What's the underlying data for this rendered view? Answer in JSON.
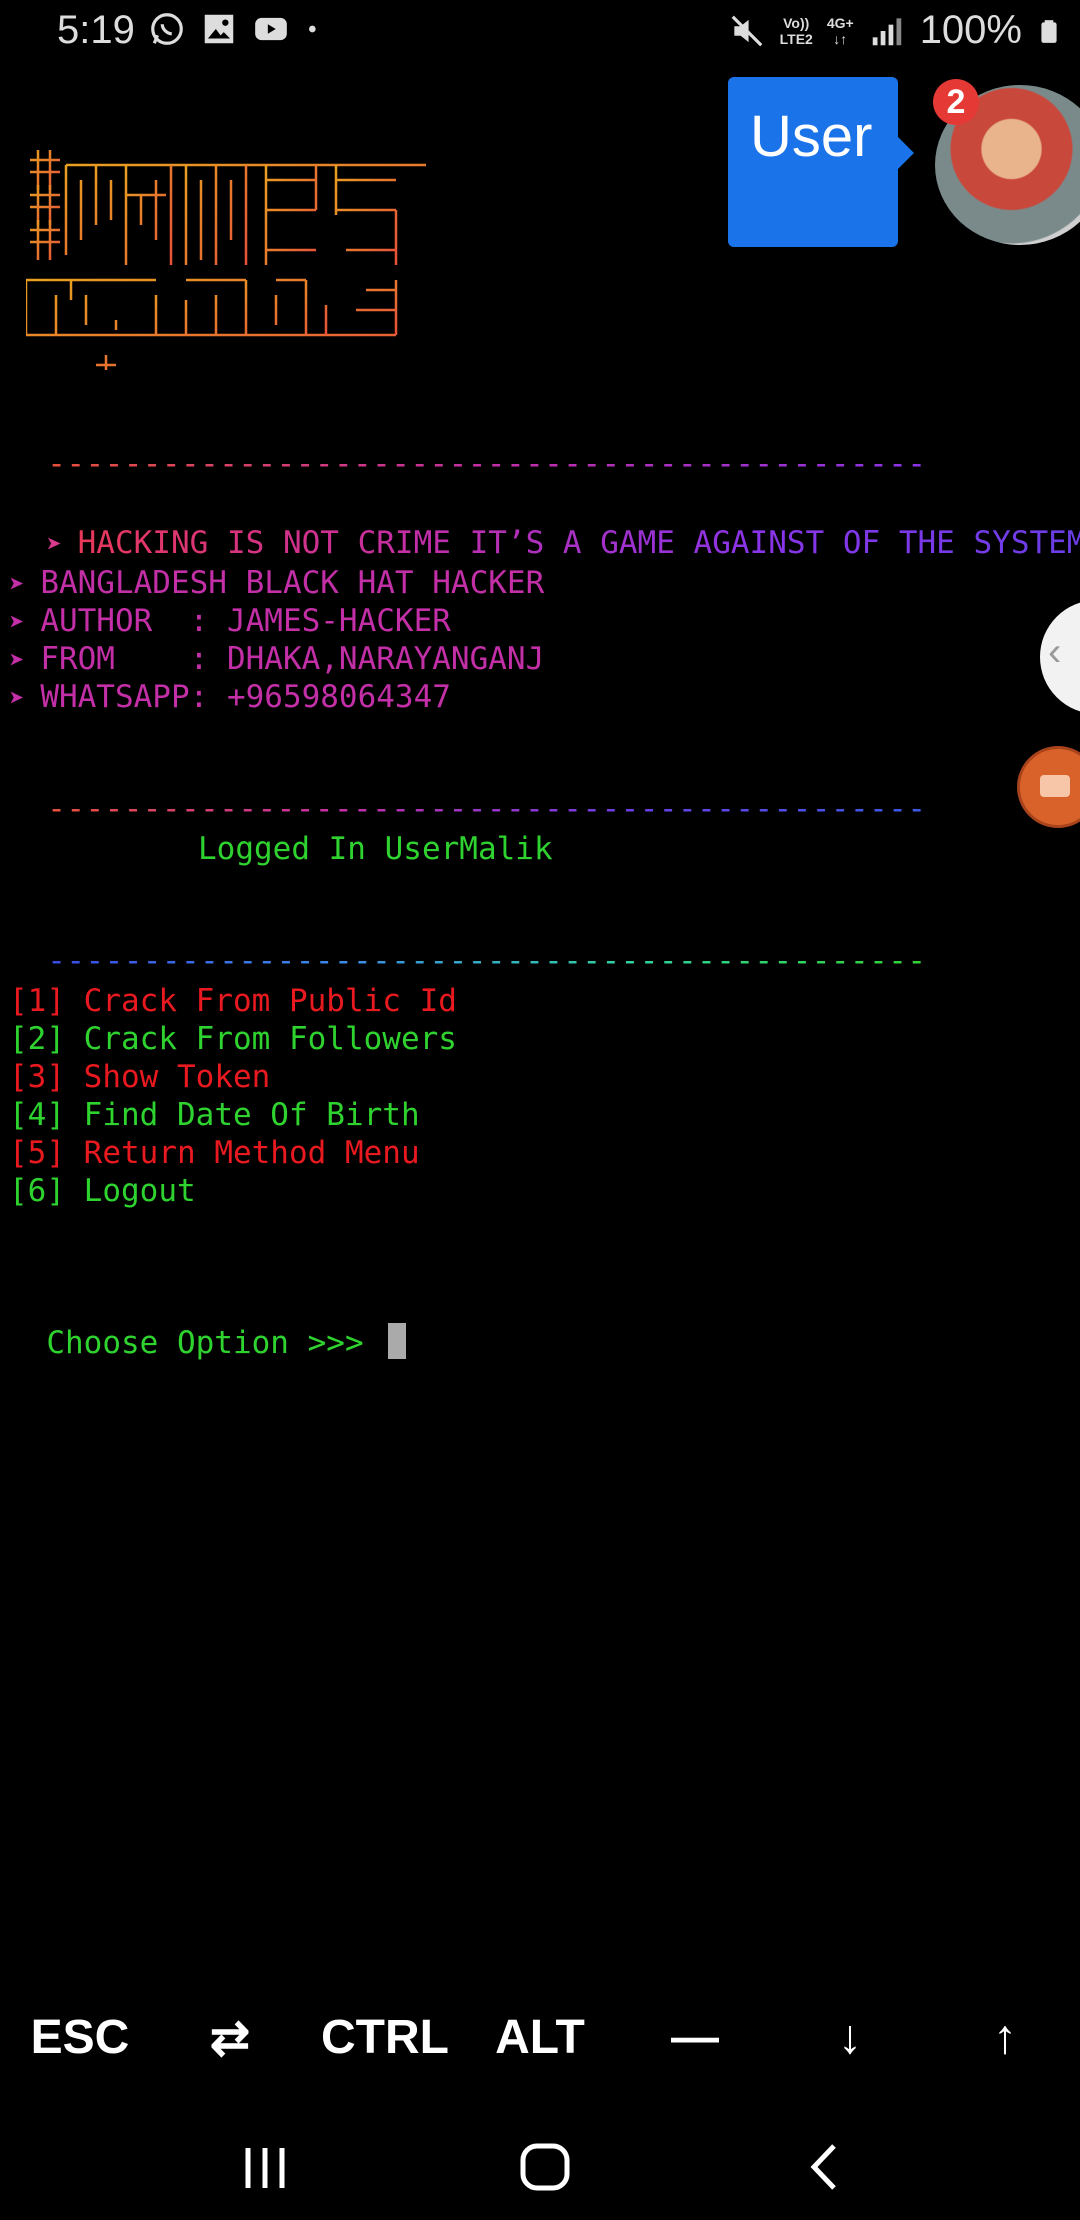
{
  "status_bar": {
    "time": "5:19",
    "network_top": "Vo))",
    "network_bottom": "LTE2",
    "net_gen": "4G+",
    "battery": "100%"
  },
  "overlay": {
    "user_label": "User",
    "badge_count": "2"
  },
  "terminal": {
    "divider": "----------------------------------------------",
    "banner_line": "HACKING IS NOT CRIME IT’S A GAME AGAINST OF THE SYSTEM",
    "info_lines": [
      "BANGLADESH BLACK HAT HACKER",
      "AUTHOR  : JAMES-HACKER",
      "FROM    : DHAKA,NARAYANGANJ",
      "WHATSAPP: +96598064347"
    ],
    "logged_in": "Logged In UserMalik",
    "menu": [
      {
        "num": "[1]",
        "label": "Crack From Public Id"
      },
      {
        "num": "[2]",
        "label": "Crack From Followers"
      },
      {
        "num": "[3]",
        "label": "Show Token"
      },
      {
        "num": "[4]",
        "label": "Find Date Of Birth"
      },
      {
        "num": "[5]",
        "label": "Return Method Menu"
      },
      {
        "num": "[6]",
        "label": "Logout"
      }
    ],
    "prompt": "Choose Option >>> "
  },
  "extra_keys": {
    "esc": "ESC",
    "tab": "⇄",
    "ctrl": "CTRL",
    "alt": "ALT",
    "dash": "—",
    "down": "↓",
    "up": "↑"
  },
  "colors": {
    "menu_red": "#e8191f",
    "menu_green": "#2fd32f",
    "accent_blue": "#1a73e8"
  }
}
